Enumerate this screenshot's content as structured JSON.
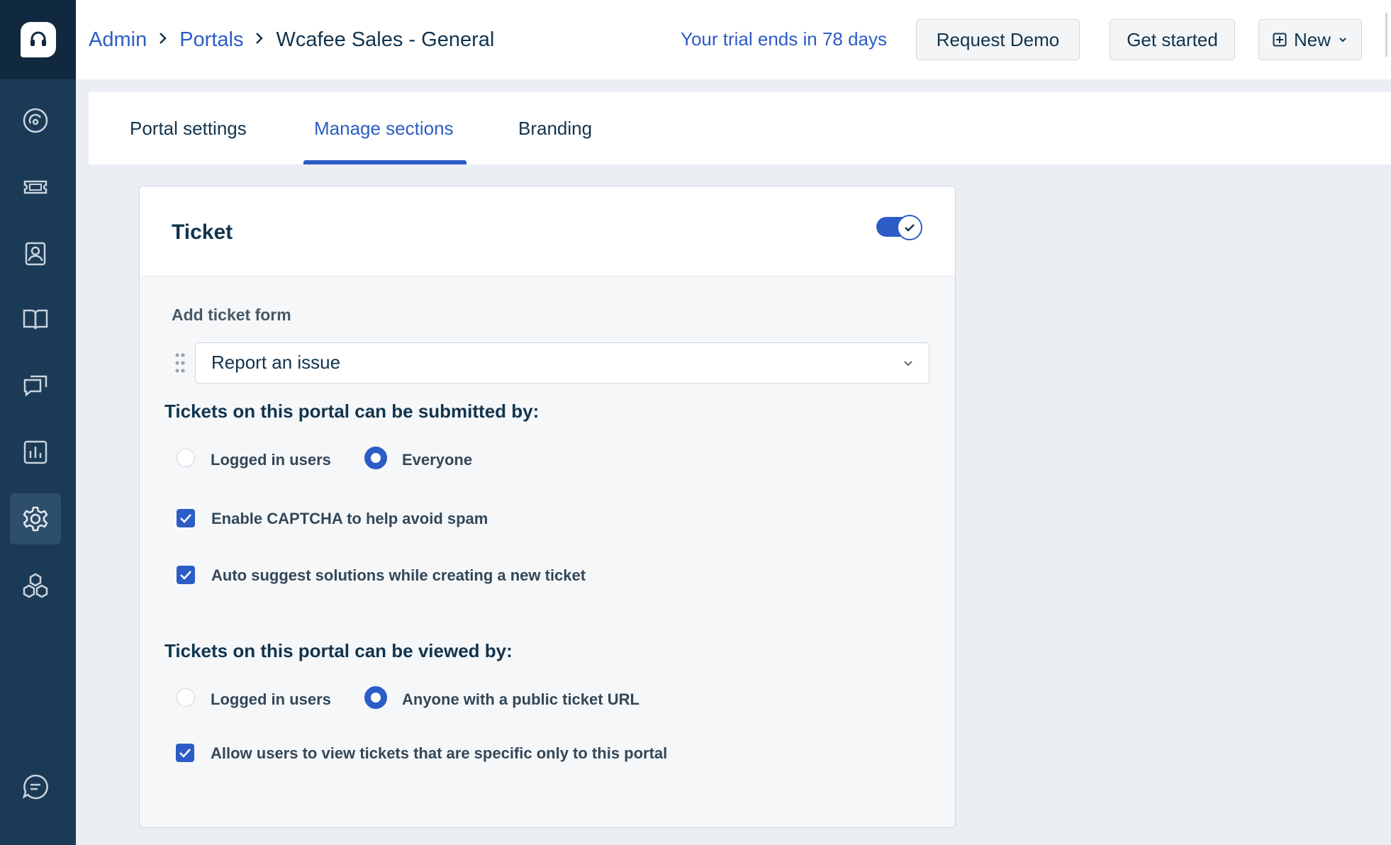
{
  "breadcrumb": {
    "admin": "Admin",
    "portals": "Portals",
    "current": "Wcafee Sales - General"
  },
  "header": {
    "trial_text": "Your trial ends in 78 days",
    "request_demo": "Request Demo",
    "get_started": "Get started",
    "new_label": "New"
  },
  "sidebar": {
    "items": [
      {
        "icon": "dashboard-icon"
      },
      {
        "icon": "tickets-icon"
      },
      {
        "icon": "contacts-icon"
      },
      {
        "icon": "solutions-book-icon"
      },
      {
        "icon": "forums-icon"
      },
      {
        "icon": "reports-icon"
      },
      {
        "icon": "gear-icon",
        "active": true
      },
      {
        "icon": "apps-icon"
      },
      {
        "icon": "chat-icon"
      }
    ]
  },
  "tabs": [
    {
      "label": "Portal settings",
      "active": false
    },
    {
      "label": "Manage sections",
      "active": true
    },
    {
      "label": "Branding",
      "active": false
    }
  ],
  "section": {
    "title": "Ticket",
    "enabled": true,
    "add_form_label": "Add ticket form",
    "form_value": "Report an issue",
    "submitted_heading": "Tickets on this portal can be submitted by:",
    "submit_options": [
      {
        "label": "Logged in users",
        "selected": false
      },
      {
        "label": "Everyone",
        "selected": true
      }
    ],
    "captcha_label": "Enable CAPTCHA to help avoid spam",
    "captcha_checked": true,
    "autosuggest_label": "Auto suggest solutions while creating a new ticket",
    "autosuggest_checked": true,
    "viewed_heading": "Tickets on this portal can be viewed by:",
    "view_options": [
      {
        "label": "Logged in users",
        "selected": false
      },
      {
        "label": "Anyone with a public ticket URL",
        "selected": true
      }
    ],
    "specific_label": "Allow users to view tickets that are specific only to this portal",
    "specific_checked": true
  },
  "colors": {
    "primary": "#2c5cc5",
    "sidebar": "#1b3a56",
    "text": "#12344d"
  }
}
